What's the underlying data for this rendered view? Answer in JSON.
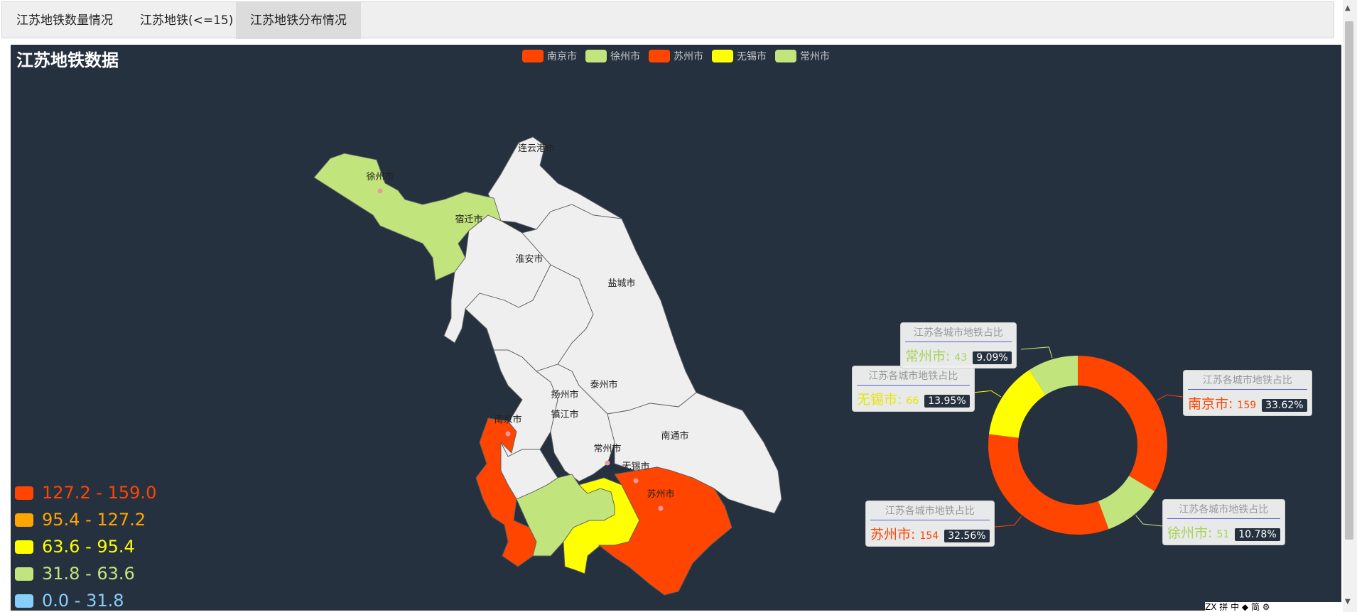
{
  "tabs": [
    {
      "label": "江苏地铁数量情况",
      "active": false
    },
    {
      "label": "江苏地铁(<=15)",
      "active": false
    },
    {
      "label": "江苏地铁分布情况",
      "active": true
    }
  ],
  "title": "江苏地铁数据",
  "legend": [
    {
      "name": "南京市",
      "color": "#ff4500"
    },
    {
      "name": "徐州市",
      "color": "#c2e47c"
    },
    {
      "name": "苏州市",
      "color": "#ff4500"
    },
    {
      "name": "无锡市",
      "color": "#ffff00"
    },
    {
      "name": "常州市",
      "color": "#c2e47c"
    }
  ],
  "visual_map": [
    {
      "label": "127.2 - 159.0",
      "color": "#ff4500"
    },
    {
      "label": "95.4 - 127.2",
      "color": "#ffa500"
    },
    {
      "label": "63.6 - 95.4",
      "color": "#ffff00"
    },
    {
      "label": "31.8 - 63.6",
      "color": "#c2e47c"
    },
    {
      "label": "0.0 - 31.8",
      "color": "#87cefa"
    }
  ],
  "map_labels": [
    "连云港市",
    "徐州市",
    "宿迁市",
    "淮安市",
    "盐城市",
    "扬州市",
    "泰州市",
    "南京市",
    "镇江市",
    "常州市",
    "无锡市",
    "南通市",
    "苏州市"
  ],
  "tooltip_title": "江苏各城市地铁占比",
  "chart_data": {
    "type": "pie",
    "title": "江苏地铁数据",
    "series_name": "江苏各城市地铁占比",
    "slices": [
      {
        "name": "南京市",
        "value": 159,
        "percent": "33.62%",
        "color": "#ff4500"
      },
      {
        "name": "徐州市",
        "value": 51,
        "percent": "10.78%",
        "color": "#c2e47c"
      },
      {
        "name": "苏州市",
        "value": 154,
        "percent": "32.56%",
        "color": "#ff4500"
      },
      {
        "name": "无锡市",
        "value": 66,
        "percent": "13.95%",
        "color": "#ffff00"
      },
      {
        "name": "常州市",
        "value": 43,
        "percent": "9.09%",
        "color": "#c2e47c"
      }
    ],
    "map_values": [
      {
        "name": "南京市",
        "value": 159
      },
      {
        "name": "徐州市",
        "value": 51
      },
      {
        "name": "苏州市",
        "value": 154
      },
      {
        "name": "无锡市",
        "value": 66
      },
      {
        "name": "常州市",
        "value": 43
      }
    ],
    "visual_map_range": [
      0,
      159
    ]
  },
  "ime_text": "ZX 拼 中 ◆ 简 ⚙"
}
